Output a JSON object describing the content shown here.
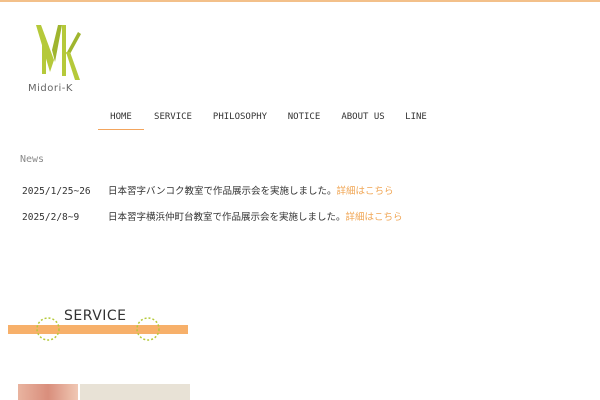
{
  "brand": {
    "logo_text": "Midori-K",
    "accent": "#b5c93a"
  },
  "nav": {
    "items": [
      {
        "label": "HOME",
        "active": true
      },
      {
        "label": "SERVICE"
      },
      {
        "label": "PHILOSOPHY"
      },
      {
        "label": "NOTICE"
      },
      {
        "label": "ABOUT US"
      },
      {
        "label": "LINE"
      }
    ]
  },
  "news": {
    "heading": "News",
    "items": [
      {
        "date": "2025/1/25~26",
        "text": "日本習字バンコク教室で作品展示会を実施しました。",
        "link": "詳細はこちら"
      },
      {
        "date": "2025/2/8~9",
        "text": "日本習字横浜仲町台教室で作品展示会を実施しました。",
        "link": "詳細はこちら"
      }
    ]
  },
  "service": {
    "title": "SERVICE",
    "bar_color": "#f7b06a"
  },
  "colors": {
    "top_rule": "#f3c08a",
    "link": "#f0a553"
  }
}
